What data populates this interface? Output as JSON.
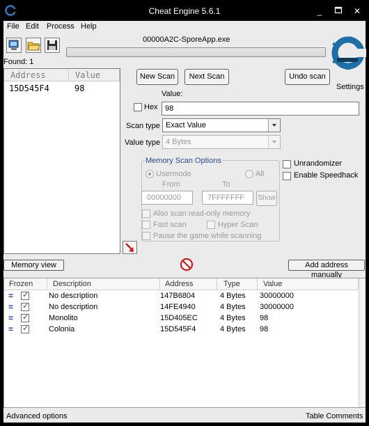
{
  "window": {
    "title": "Cheat Engine 5.6.1"
  },
  "menu": [
    "File",
    "Edit",
    "Process",
    "Help"
  ],
  "process_name": "00000A2C-SporeApp.exe",
  "found_label": "Found: 1",
  "results": {
    "col_address": "Address",
    "col_value": "Value",
    "rows": [
      {
        "address": "15D545F4",
        "value": "98"
      }
    ]
  },
  "buttons": {
    "new_scan": "New Scan",
    "next_scan": "Next Scan",
    "undo_scan": "Undo scan",
    "settings": "Settings",
    "memory_view": "Memory view",
    "add_address": "Add address manually",
    "show": "Show"
  },
  "scan": {
    "value_label": "Value:",
    "hex_label": "Hex",
    "value": "98",
    "scan_type_label": "Scan type",
    "scan_type": "Exact Value",
    "value_type_label": "Value type",
    "value_type": "4 Bytes"
  },
  "memory_scan": {
    "title": "Memory Scan Options",
    "usermode": "Usermode",
    "all": "All",
    "from_label": "From",
    "to_label": "To",
    "from": "00000000",
    "to": "7FFFFFFF",
    "readonly": "Also scan read-only memory",
    "fast_scan": "Fast scan",
    "hyper_scan": "Hyper Scan",
    "pause": "Pause the game while scanning"
  },
  "options": {
    "unrandomizer": "Unrandomizer",
    "speedhack": "Enable Speedhack"
  },
  "table": {
    "headers": {
      "frozen": "Frozen",
      "description": "Description",
      "address": "Address",
      "type": "Type",
      "value": "Value"
    },
    "rows": [
      {
        "description": "No description",
        "address": "147B6804",
        "type": "4 Bytes",
        "value": "30000000"
      },
      {
        "description": "No description",
        "address": "14FE4940",
        "type": "4 Bytes",
        "value": "30000000"
      },
      {
        "description": "Monolito",
        "address": "15D405EC",
        "type": "4 Bytes",
        "value": "98"
      },
      {
        "description": "Colonia",
        "address": "15D545F4",
        "type": "4 Bytes",
        "value": "98"
      }
    ]
  },
  "status": {
    "left": "Advanced options",
    "right": "Table Comments"
  },
  "colors": {
    "frozen_marker": "#1a3fb0",
    "stop_icon": "#d41818",
    "logo": "#1d6fa8"
  }
}
